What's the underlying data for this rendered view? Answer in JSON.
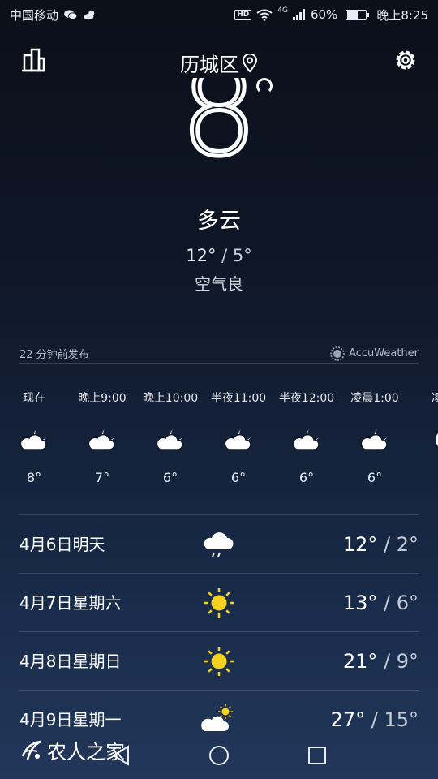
{
  "status_bar": {
    "carrier": "中国移动",
    "hd": "HD",
    "network": "4G",
    "battery_percent": "60%",
    "battery_level": 0.6,
    "time": "晚上8:25"
  },
  "header": {
    "location": "历城区"
  },
  "current": {
    "temperature": "8",
    "condition": "多云",
    "high": "12°",
    "separator": " / ",
    "low": "5°",
    "air_quality": "空气良"
  },
  "publish": {
    "time_text": "22 分钟前发布",
    "provider": "AccuWeather"
  },
  "hourly": [
    {
      "time": "现在",
      "temp": "8°",
      "icon": "partly-cloudy-night-icon"
    },
    {
      "time": "晚上9:00",
      "temp": "7°",
      "icon": "partly-cloudy-night-icon"
    },
    {
      "time": "晚上10:00",
      "temp": "6°",
      "icon": "partly-cloudy-night-icon"
    },
    {
      "time": "半夜11:00",
      "temp": "6°",
      "icon": "partly-cloudy-night-icon"
    },
    {
      "time": "半夜12:00",
      "temp": "6°",
      "icon": "partly-cloudy-night-icon"
    },
    {
      "time": "凌晨1:00",
      "temp": "6°",
      "icon": "partly-cloudy-night-icon"
    },
    {
      "time": "凌晨",
      "temp": "",
      "icon": "moon-icon"
    }
  ],
  "daily": [
    {
      "date": "4月6日明天",
      "icon": "rain-cloud-icon",
      "high": "12°",
      "low": "2°"
    },
    {
      "date": "4月7日星期六",
      "icon": "sun-icon",
      "high": "13°",
      "low": "6°"
    },
    {
      "date": "4月8日星期日",
      "icon": "sun-icon",
      "high": "21°",
      "low": "9°"
    },
    {
      "date": "4月9日星期一",
      "icon": "partly-cloudy-day-icon",
      "high": "27°",
      "low": "15°"
    }
  ],
  "watermark": "农人之家",
  "colors": {
    "sun": "#f5d21e",
    "cloud": "#ffffff",
    "background_top": "#0b0f18",
    "background_bottom": "#22375a"
  }
}
